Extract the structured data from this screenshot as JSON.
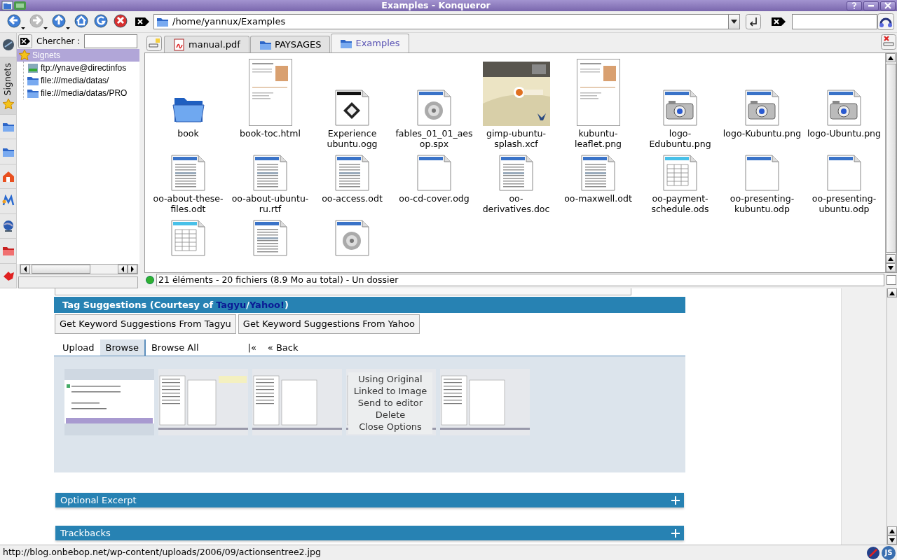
{
  "window": {
    "title": "Examples - Konqueror"
  },
  "toolbar": {
    "buttons": [
      {
        "kind": "back",
        "disabled": false
      },
      {
        "kind": "forward",
        "disabled": true
      },
      {
        "kind": "up",
        "disabled": false
      },
      {
        "kind": "home",
        "disabled": false
      },
      {
        "kind": "reload",
        "disabled": false
      },
      {
        "kind": "stop",
        "disabled": false
      }
    ],
    "location": "/home/yannux/Examples"
  },
  "sidebar": {
    "search_label": "Chercher :",
    "tabs": [
      {
        "kind": "history",
        "selected": false
      },
      {
        "kind": "bookmarks",
        "label": "Signets",
        "selected": true
      },
      {
        "kind": "folder",
        "selected": false
      },
      {
        "kind": "folder",
        "selected": false
      },
      {
        "kind": "home",
        "selected": false
      },
      {
        "kind": "media",
        "selected": false
      },
      {
        "kind": "network",
        "selected": false
      },
      {
        "kind": "redfolder",
        "selected": false
      },
      {
        "kind": "services",
        "selected": false
      }
    ],
    "tree": {
      "label": "Signets",
      "selected": true,
      "children": [
        {
          "label": "ftp://ynave@directinfos",
          "kind": "ftp"
        },
        {
          "label": "file:///media/datas/",
          "kind": "folder"
        },
        {
          "label": "file:///media/datas/PRO",
          "kind": "folder"
        }
      ]
    }
  },
  "tabs": [
    {
      "label": "manual.pdf",
      "kind": "pdf",
      "selected": false
    },
    {
      "label": "PAYSAGES",
      "kind": "folder",
      "selected": false
    },
    {
      "label": "Examples",
      "kind": "folder",
      "selected": true
    }
  ],
  "files": [
    {
      "name": "book",
      "kind": "folder"
    },
    {
      "name": "book-toc.html",
      "kind": "preview"
    },
    {
      "name": "Experience ubuntu.ogg",
      "kind": "video"
    },
    {
      "name": "fables_01_01_aesop.spx",
      "kind": "sound"
    },
    {
      "name": "gimp-ubuntu-splash.xcf",
      "kind": "picture"
    },
    {
      "name": "kubuntu-leaflet.png",
      "kind": "preview"
    },
    {
      "name": "logo-Edubuntu.png"
    },
    {
      "name": "logo-Kubuntu.png"
    },
    {
      "name": "logo-Ubuntu.png"
    },
    {
      "name": "oo-about-these-files.odt",
      "kind": "text"
    },
    {
      "name": "oo-about-ubuntu-ru.rtf",
      "kind": "text"
    },
    {
      "name": "oo-access.odt",
      "kind": "text"
    },
    {
      "name": "oo-cd-cover.odg",
      "kind": "blank"
    },
    {
      "name": "oo-derivatives.doc",
      "kind": "text"
    },
    {
      "name": "oo-maxwell.odt",
      "kind": "text"
    },
    {
      "name": "oo-payment-schedule.ods",
      "kind": "spreadsheet"
    },
    {
      "name": "oo-presenting-kubuntu.odp",
      "kind": "blank"
    },
    {
      "name": "oo-presenting-ubuntu.odp",
      "kind": "blank"
    },
    {
      "kind": "spreadsheet"
    },
    {
      "kind": "text"
    },
    {
      "kind": "sound"
    }
  ],
  "status": "21 éléments - 20 fichiers (8.9 Mo au total) - Un dossier",
  "link_view": {
    "checked": false
  },
  "page": {
    "panel_title": {
      "before": "Tag Suggestions (Courtesy of",
      "links": [
        "Tagyu",
        "Yahoo!"
      ],
      "separator": "/",
      "after": ")"
    },
    "buttons": [
      "Get Keyword Suggestions From Tagyu",
      "Get Keyword Suggestions From Yahoo"
    ],
    "media_tabs": [
      {
        "label": "Upload",
        "selected": false
      },
      {
        "label": "Browse",
        "selected": true
      },
      {
        "label": "Browse All",
        "selected": false
      },
      {
        "label": "|«",
        "selected": false
      },
      {
        "label": "« Back",
        "selected": false
      }
    ],
    "thumbnails": [
      {
        "kind": "picture"
      },
      {
        "kind": "picture"
      },
      {
        "kind": "picture"
      },
      {
        "kind": "picture",
        "options": [
          "Using Original",
          "Linked to Image",
          "Send to editor",
          "Delete",
          "Close Options"
        ]
      },
      {
        "kind": "picture"
      }
    ],
    "sections": [
      {
        "title": "Optional Excerpt",
        "expanded": false
      },
      {
        "title": "Trackbacks",
        "expanded": false
      }
    ]
  },
  "status_bar": {
    "url": "http://blog.onbebop.net/wp-content/uploads/2006/09/actionsentree2.jpg",
    "js_badge": "JS"
  }
}
